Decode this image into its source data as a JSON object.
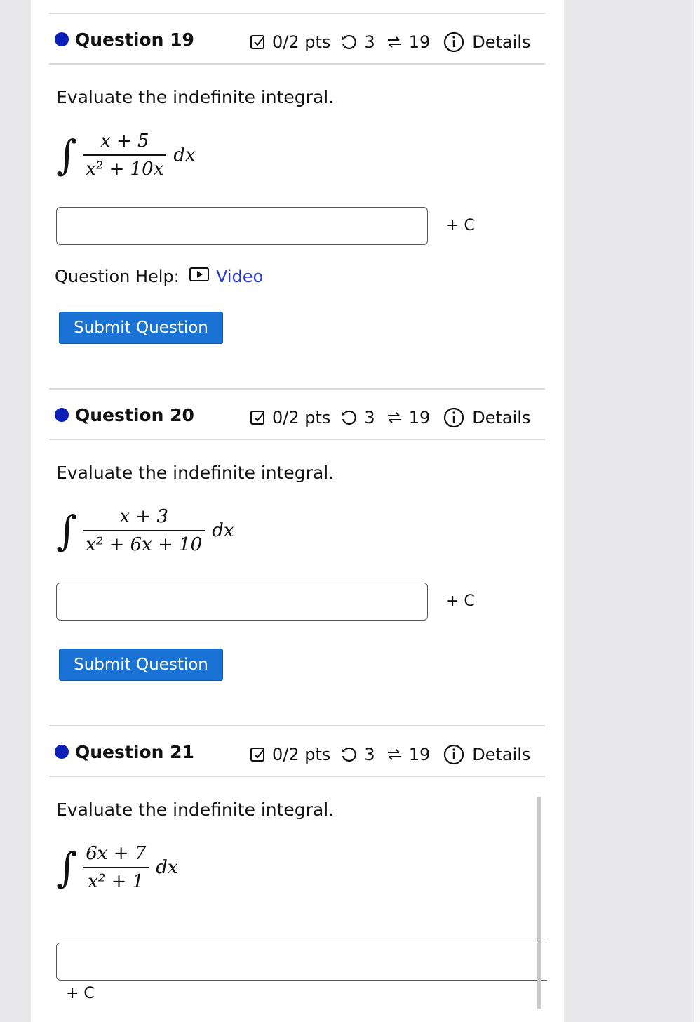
{
  "questions": [
    {
      "title": "Question 19",
      "points": "0/2 pts",
      "retries": "3",
      "attempts": "19",
      "details_label": "Details",
      "prompt": "Evaluate the indefinite integral.",
      "numerator": "x + 5",
      "denominator": "x² + 10x",
      "differential": "dx",
      "constant_label": "+ C",
      "answer_value": "",
      "help_label": "Question Help:",
      "video_label": "Video",
      "submit_label": "Submit Question"
    },
    {
      "title": "Question 20",
      "points": "0/2 pts",
      "retries": "3",
      "attempts": "19",
      "details_label": "Details",
      "prompt": "Evaluate the indefinite integral.",
      "numerator": "x + 3",
      "denominator": "x² + 6x + 10",
      "differential": "dx",
      "constant_label": "+ C",
      "answer_value": "",
      "submit_label": "Submit Question"
    },
    {
      "title": "Question 21",
      "points": "0/2 pts",
      "retries": "3",
      "attempts": "19",
      "details_label": "Details",
      "prompt": "Evaluate the indefinite integral.",
      "numerator": "6x + 7",
      "denominator": "x² + 1",
      "differential": "dx",
      "constant_label": "+ C",
      "answer_value": ""
    }
  ],
  "colors": {
    "accent_dot": "#0b1fb8",
    "submit_button": "#1a73d4",
    "link": "#2a3ad6"
  }
}
